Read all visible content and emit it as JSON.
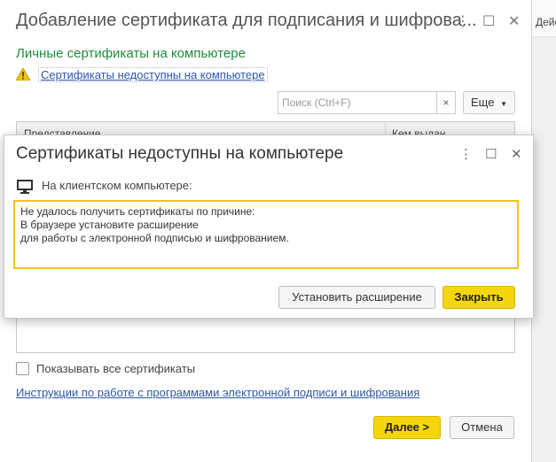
{
  "window": {
    "title": "Добавление сертификата для подписания и шифрова...",
    "right_cut_text": "Дейс",
    "section_title": "Личные сертификаты на компьютере",
    "warning_link": "Сертификаты недоступны на компьютере",
    "search_placeholder": "Поиск (Ctrl+F)",
    "search_clear": "×",
    "more_button": "Еще",
    "table_headers": [
      "Представление",
      "Кем выдан"
    ],
    "show_all_label": "Показывать все сертификаты",
    "instructions_link": "Инструкции по работе с программами электронной подписи и шифрования",
    "next_button": "Далее >",
    "cancel_button": "Отмена"
  },
  "dialog": {
    "title": "Сертификаты недоступны на компьютере",
    "client_label": "На клиентском компьютере:",
    "message": "Не удалось получить сертификаты по причине:\nВ браузере установите расширение\nдля работы с электронной подписью и шифрованием.",
    "install_button": "Установить расширение",
    "close_button": "Закрыть"
  },
  "icons": {
    "more": "more-vertical-icon",
    "maximize": "maximize-icon",
    "close": "close-icon",
    "warning": "warning-icon",
    "monitor": "monitor-icon",
    "dropdown": "chevron-down-icon"
  },
  "colors": {
    "accent_green": "#1f8c3d",
    "link_blue": "#2a57a8",
    "primary_button": "#f4d60f",
    "message_border": "#f0c419"
  }
}
